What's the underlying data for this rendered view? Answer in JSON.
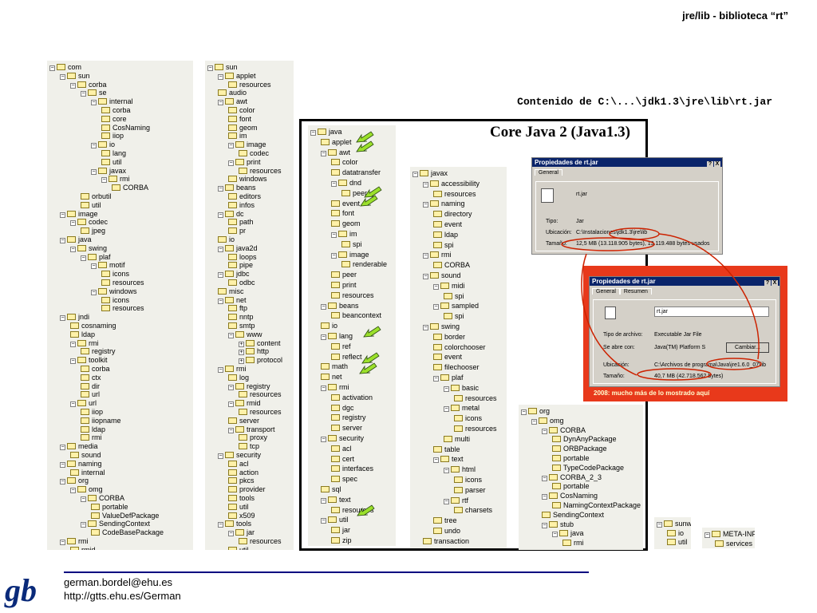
{
  "header": {
    "title": "jre/lib - biblioteca “rt”"
  },
  "caption": "Contenido de C:\\...\\jdk1.3\\jre\\lib\\rt.jar",
  "core_title": "Core Java 2 (Java1.3)",
  "trees": {
    "com": [
      [
        0,
        "m",
        "com"
      ],
      [
        1,
        "m",
        "sun"
      ],
      [
        2,
        "m",
        "corba"
      ],
      [
        3,
        "m",
        "se"
      ],
      [
        4,
        "m",
        "internal"
      ],
      [
        5,
        "",
        "corba"
      ],
      [
        5,
        "",
        "core"
      ],
      [
        5,
        "",
        "CosNaming"
      ],
      [
        5,
        "",
        "iiop"
      ],
      [
        4,
        "m",
        "io"
      ],
      [
        5,
        "",
        "lang"
      ],
      [
        5,
        "",
        "util"
      ],
      [
        4,
        "m",
        "javax"
      ],
      [
        5,
        "m",
        "rmi"
      ],
      [
        6,
        "",
        "CORBA"
      ],
      [
        3,
        "",
        "orbutil"
      ],
      [
        3,
        "",
        "util"
      ],
      [
        1,
        "m",
        "image"
      ],
      [
        2,
        "m",
        "codec"
      ],
      [
        3,
        "",
        "jpeg"
      ],
      [
        1,
        "m",
        "java"
      ],
      [
        2,
        "m",
        "swing"
      ],
      [
        3,
        "m",
        "plaf"
      ],
      [
        4,
        "m",
        "motif"
      ],
      [
        5,
        "",
        "icons"
      ],
      [
        5,
        "",
        "resources"
      ],
      [
        4,
        "m",
        "windows"
      ],
      [
        5,
        "",
        "icons"
      ],
      [
        5,
        "",
        "resources"
      ],
      [
        1,
        "m",
        "jndi"
      ],
      [
        2,
        "",
        "cosnaming"
      ],
      [
        2,
        "",
        "ldap"
      ],
      [
        2,
        "m",
        "rmi"
      ],
      [
        3,
        "",
        "registry"
      ],
      [
        2,
        "m",
        "toolkit"
      ],
      [
        3,
        "",
        "corba"
      ],
      [
        3,
        "",
        "ctx"
      ],
      [
        3,
        "",
        "dir"
      ],
      [
        3,
        "",
        "url"
      ],
      [
        2,
        "m",
        "url"
      ],
      [
        3,
        "",
        "iiop"
      ],
      [
        3,
        "",
        "iiopname"
      ],
      [
        3,
        "",
        "ldap"
      ],
      [
        3,
        "",
        "rmi"
      ],
      [
        1,
        "m",
        "media"
      ],
      [
        2,
        "",
        "sound"
      ],
      [
        1,
        "m",
        "naming"
      ],
      [
        2,
        "",
        "internal"
      ],
      [
        1,
        "m",
        "org"
      ],
      [
        2,
        "m",
        "omg"
      ],
      [
        3,
        "m",
        "CORBA"
      ],
      [
        4,
        "",
        "portable"
      ],
      [
        4,
        "",
        "ValueDefPackage"
      ],
      [
        3,
        "m",
        "SendingContext"
      ],
      [
        4,
        "",
        "CodeBasePackage"
      ],
      [
        1,
        "m",
        "rmi"
      ],
      [
        2,
        "",
        "rmid"
      ]
    ],
    "sun": [
      [
        0,
        "m",
        "sun"
      ],
      [
        1,
        "m",
        "applet"
      ],
      [
        2,
        "",
        "resources"
      ],
      [
        1,
        "",
        "audio"
      ],
      [
        1,
        "m",
        "awt"
      ],
      [
        2,
        "",
        "color"
      ],
      [
        2,
        "",
        "font"
      ],
      [
        2,
        "",
        "geom"
      ],
      [
        2,
        "",
        "im"
      ],
      [
        2,
        "m",
        "image"
      ],
      [
        3,
        "",
        "codec"
      ],
      [
        2,
        "m",
        "print"
      ],
      [
        3,
        "",
        "resources"
      ],
      [
        2,
        "",
        "windows"
      ],
      [
        1,
        "m",
        "beans"
      ],
      [
        2,
        "",
        "editors"
      ],
      [
        2,
        "",
        "infos"
      ],
      [
        1,
        "m",
        "dc"
      ],
      [
        2,
        "",
        "path"
      ],
      [
        2,
        "",
        "pr"
      ],
      [
        1,
        "",
        "io"
      ],
      [
        1,
        "m",
        "java2d"
      ],
      [
        2,
        "",
        "loops"
      ],
      [
        2,
        "",
        "pipe"
      ],
      [
        1,
        "m",
        "jdbc"
      ],
      [
        2,
        "",
        "odbc"
      ],
      [
        1,
        "",
        "misc"
      ],
      [
        1,
        "m",
        "net"
      ],
      [
        2,
        "",
        "ftp"
      ],
      [
        2,
        "",
        "nntp"
      ],
      [
        2,
        "",
        "smtp"
      ],
      [
        2,
        "m",
        "www"
      ],
      [
        3,
        "p",
        "content"
      ],
      [
        3,
        "p",
        "http"
      ],
      [
        3,
        "p",
        "protocol"
      ],
      [
        1,
        "m",
        "rmi"
      ],
      [
        2,
        "",
        "log"
      ],
      [
        2,
        "m",
        "registry"
      ],
      [
        3,
        "",
        "resources"
      ],
      [
        2,
        "m",
        "rmid"
      ],
      [
        3,
        "",
        "resources"
      ],
      [
        2,
        "",
        "server"
      ],
      [
        2,
        "m",
        "transport"
      ],
      [
        3,
        "",
        "proxy"
      ],
      [
        3,
        "",
        "tcp"
      ],
      [
        1,
        "m",
        "security"
      ],
      [
        2,
        "",
        "acl"
      ],
      [
        2,
        "",
        "action"
      ],
      [
        2,
        "",
        "pkcs"
      ],
      [
        2,
        "",
        "provider"
      ],
      [
        2,
        "",
        "tools"
      ],
      [
        2,
        "",
        "util"
      ],
      [
        2,
        "",
        "x509"
      ],
      [
        1,
        "m",
        "tools"
      ],
      [
        2,
        "m",
        "jar"
      ],
      [
        3,
        "",
        "resources"
      ],
      [
        2,
        "",
        "util"
      ]
    ],
    "java": [
      [
        0,
        "m",
        "java"
      ],
      [
        1,
        "",
        "applet"
      ],
      [
        1,
        "m",
        "awt"
      ],
      [
        2,
        "",
        "color"
      ],
      [
        2,
        "",
        "datatransfer"
      ],
      [
        2,
        "m",
        "dnd"
      ],
      [
        3,
        "",
        "peer"
      ],
      [
        2,
        "",
        "event"
      ],
      [
        2,
        "",
        "font"
      ],
      [
        2,
        "",
        "geom"
      ],
      [
        2,
        "m",
        "im"
      ],
      [
        3,
        "",
        "spi"
      ],
      [
        2,
        "m",
        "image"
      ],
      [
        3,
        "",
        "renderable"
      ],
      [
        2,
        "",
        "peer"
      ],
      [
        2,
        "",
        "print"
      ],
      [
        2,
        "",
        "resources"
      ],
      [
        1,
        "m",
        "beans"
      ],
      [
        2,
        "",
        "beancontext"
      ],
      [
        1,
        "",
        "io"
      ],
      [
        1,
        "m",
        "lang"
      ],
      [
        2,
        "",
        "ref"
      ],
      [
        2,
        "",
        "reflect"
      ],
      [
        1,
        "",
        "math"
      ],
      [
        1,
        "",
        "net"
      ],
      [
        1,
        "m",
        "rmi"
      ],
      [
        2,
        "",
        "activation"
      ],
      [
        2,
        "",
        "dgc"
      ],
      [
        2,
        "",
        "registry"
      ],
      [
        2,
        "",
        "server"
      ],
      [
        1,
        "m",
        "security"
      ],
      [
        2,
        "",
        "acl"
      ],
      [
        2,
        "",
        "cert"
      ],
      [
        2,
        "",
        "interfaces"
      ],
      [
        2,
        "",
        "spec"
      ],
      [
        1,
        "",
        "sql"
      ],
      [
        1,
        "m",
        "text"
      ],
      [
        2,
        "",
        "resources"
      ],
      [
        1,
        "m",
        "util"
      ],
      [
        2,
        "",
        "jar"
      ],
      [
        2,
        "",
        "zip"
      ]
    ],
    "javax": [
      [
        0,
        "m",
        "javax"
      ],
      [
        1,
        "m",
        "accessibility"
      ],
      [
        2,
        "",
        "resources"
      ],
      [
        1,
        "m",
        "naming"
      ],
      [
        2,
        "",
        "directory"
      ],
      [
        2,
        "",
        "event"
      ],
      [
        2,
        "",
        "ldap"
      ],
      [
        2,
        "",
        "spi"
      ],
      [
        1,
        "m",
        "rmi"
      ],
      [
        2,
        "",
        "CORBA"
      ],
      [
        1,
        "m",
        "sound"
      ],
      [
        2,
        "m",
        "midi"
      ],
      [
        3,
        "",
        "spi"
      ],
      [
        2,
        "m",
        "sampled"
      ],
      [
        3,
        "",
        "spi"
      ],
      [
        1,
        "m",
        "swing"
      ],
      [
        2,
        "",
        "border"
      ],
      [
        2,
        "",
        "colorchooser"
      ],
      [
        2,
        "",
        "event"
      ],
      [
        2,
        "",
        "filechooser"
      ],
      [
        2,
        "m",
        "plaf"
      ],
      [
        3,
        "m",
        "basic"
      ],
      [
        4,
        "",
        "resources"
      ],
      [
        3,
        "m",
        "metal"
      ],
      [
        4,
        "",
        "icons"
      ],
      [
        4,
        "",
        "resources"
      ],
      [
        3,
        "",
        "multi"
      ],
      [
        2,
        "",
        "table"
      ],
      [
        2,
        "m",
        "text"
      ],
      [
        3,
        "m",
        "html"
      ],
      [
        4,
        "",
        "icons"
      ],
      [
        4,
        "",
        "parser"
      ],
      [
        3,
        "m",
        "rtf"
      ],
      [
        4,
        "",
        "charsets"
      ],
      [
        2,
        "",
        "tree"
      ],
      [
        2,
        "",
        "undo"
      ],
      [
        1,
        "",
        "transaction"
      ]
    ],
    "org": [
      [
        0,
        "m",
        "org"
      ],
      [
        1,
        "m",
        "omg"
      ],
      [
        2,
        "m",
        "CORBA"
      ],
      [
        3,
        "",
        "DynAnyPackage"
      ],
      [
        3,
        "",
        "ORBPackage"
      ],
      [
        3,
        "",
        "portable"
      ],
      [
        3,
        "",
        "TypeCodePackage"
      ],
      [
        2,
        "m",
        "CORBA_2_3"
      ],
      [
        3,
        "",
        "portable"
      ],
      [
        2,
        "m",
        "CosNaming"
      ],
      [
        3,
        "",
        "NamingContextPackage"
      ],
      [
        2,
        "",
        "SendingContext"
      ],
      [
        2,
        "m",
        "stub"
      ],
      [
        3,
        "m",
        "java"
      ],
      [
        4,
        "",
        "rmi"
      ]
    ],
    "sunw": [
      [
        0,
        "m",
        "sunw"
      ],
      [
        1,
        "",
        "io"
      ],
      [
        1,
        "",
        "util"
      ]
    ],
    "metainf": [
      [
        0,
        "m",
        "META-INF"
      ],
      [
        1,
        "",
        "services"
      ]
    ]
  },
  "dialog1": {
    "title": "Propiedades de rt.jar",
    "tab": "General",
    "file": "rt.jar",
    "rows": [
      [
        "Tipo:",
        "Jar"
      ],
      [
        "Ubicación:",
        "C:\\Instalaciones\\jdk1.3\\jre\\lib"
      ],
      [
        "Tamaño:",
        "12,5 MB (13.118.905 bytes), 13.119.488 bytes usados"
      ]
    ],
    "buttons": [
      "?",
      "X"
    ]
  },
  "dialog2": {
    "title": "Propiedades de rt.jar",
    "tabs": [
      "General",
      "Resumen"
    ],
    "file": "rt.jar",
    "rows": [
      [
        "Tipo de archivo:",
        "Executable Jar File"
      ],
      [
        "Se abre con:",
        "Java(TM) Platform S"
      ],
      [
        "Ubicación:",
        "C:\\Archivos de programa\\Java\\jre1.6.0_07\\lib"
      ],
      [
        "Tamaño:",
        "40,7 MB (42.718.562 bytes)"
      ]
    ],
    "change_button": "Cambiar...",
    "buttons": [
      "?",
      "X"
    ]
  },
  "red_note": "2008: mucho más de lo mostrado aquí",
  "footer": {
    "logo": "gb",
    "email": "german.bordel@ehu.es",
    "url": "http://gtts.ehu.es/German"
  },
  "colors": {
    "red_box": "#e8391b",
    "arrow_fill": "#9be02b",
    "highlight": "#cc2200",
    "title_bar": "#0a246a"
  }
}
